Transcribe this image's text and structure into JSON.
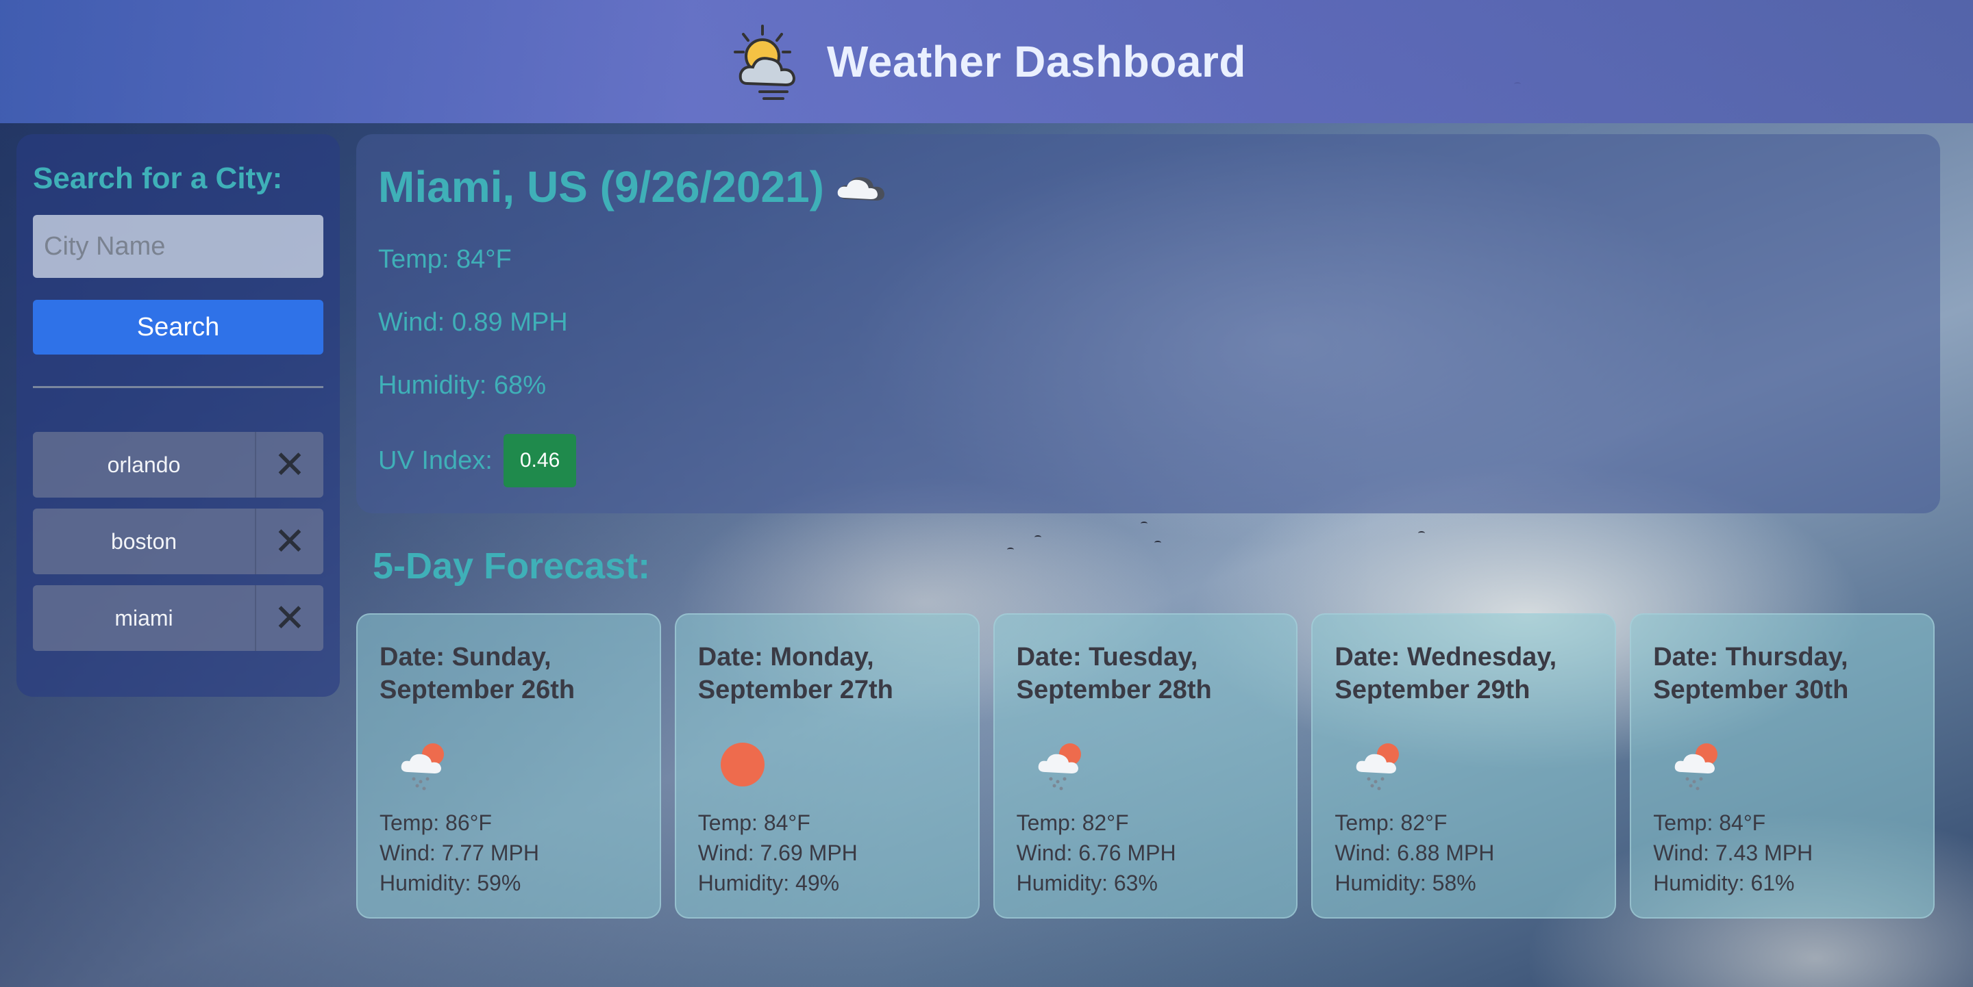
{
  "header": {
    "title": "Weather Dashboard",
    "icon": "sun-behind-cloud-icon"
  },
  "sidebar": {
    "title": "Search for a City:",
    "input_placeholder": "City Name",
    "search_label": "Search",
    "history": [
      {
        "city": "orlando",
        "remove": "✕"
      },
      {
        "city": "boston",
        "remove": "✕"
      },
      {
        "city": "miami",
        "remove": "✕"
      }
    ]
  },
  "current": {
    "heading": "Miami, US (9/26/2021)",
    "icon": "cloud-icon",
    "temp": "Temp: 84°F",
    "wind": "Wind: 0.89 MPH",
    "humidity": "Humidity: 68%",
    "uv_label": "UV Index:",
    "uv_value": "0.46",
    "uv_color": "#1f8a4c"
  },
  "forecast": {
    "heading": "5-Day Forecast:",
    "days": [
      {
        "date": "Date: Sunday, September 26th",
        "icon": "rain-cloud-sun-icon",
        "temp": "Temp: 86°F",
        "wind": "Wind: 7.77 MPH",
        "humidity": "Humidity: 59%"
      },
      {
        "date": "Date: Monday, September 27th",
        "icon": "sun-icon",
        "temp": "Temp: 84°F",
        "wind": "Wind: 7.69 MPH",
        "humidity": "Humidity: 49%"
      },
      {
        "date": "Date: Tuesday, September 28th",
        "icon": "rain-cloud-sun-icon",
        "temp": "Temp: 82°F",
        "wind": "Wind: 6.76 MPH",
        "humidity": "Humidity: 63%"
      },
      {
        "date": "Date: Wednesday, September 29th",
        "icon": "rain-cloud-sun-icon",
        "temp": "Temp: 82°F",
        "wind": "Wind: 6.88 MPH",
        "humidity": "Humidity: 58%"
      },
      {
        "date": "Date: Thursday, September 30th",
        "icon": "rain-cloud-sun-icon",
        "temp": "Temp: 84°F",
        "wind": "Wind: 7.43 MPH",
        "humidity": "Humidity: 61%"
      }
    ]
  }
}
